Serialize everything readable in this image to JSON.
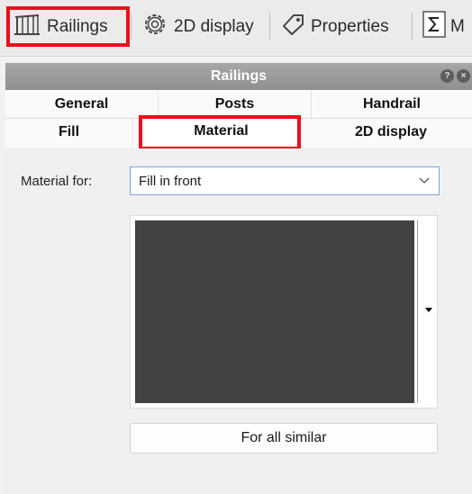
{
  "toolbar": {
    "items": [
      {
        "label": "Railings",
        "icon": "railing-icon"
      },
      {
        "label": "2D display",
        "icon": "gear-icon"
      },
      {
        "label": "Properties",
        "icon": "tag-icon"
      },
      {
        "label": "M",
        "icon": "sigma-icon"
      }
    ]
  },
  "panel": {
    "title": "Railings",
    "controls": [
      "help-icon",
      "close-icon"
    ]
  },
  "tabs": {
    "row1": [
      "General",
      "Posts",
      "Handrail"
    ],
    "row2": [
      "Fill",
      "Material",
      "2D display"
    ],
    "active": "Material"
  },
  "form": {
    "material_for_label": "Material for:",
    "material_for_value": "Fill in front",
    "swatch_color": "#424242",
    "for_all_similar": "For all similar"
  },
  "highlight_color": "#e8101b"
}
